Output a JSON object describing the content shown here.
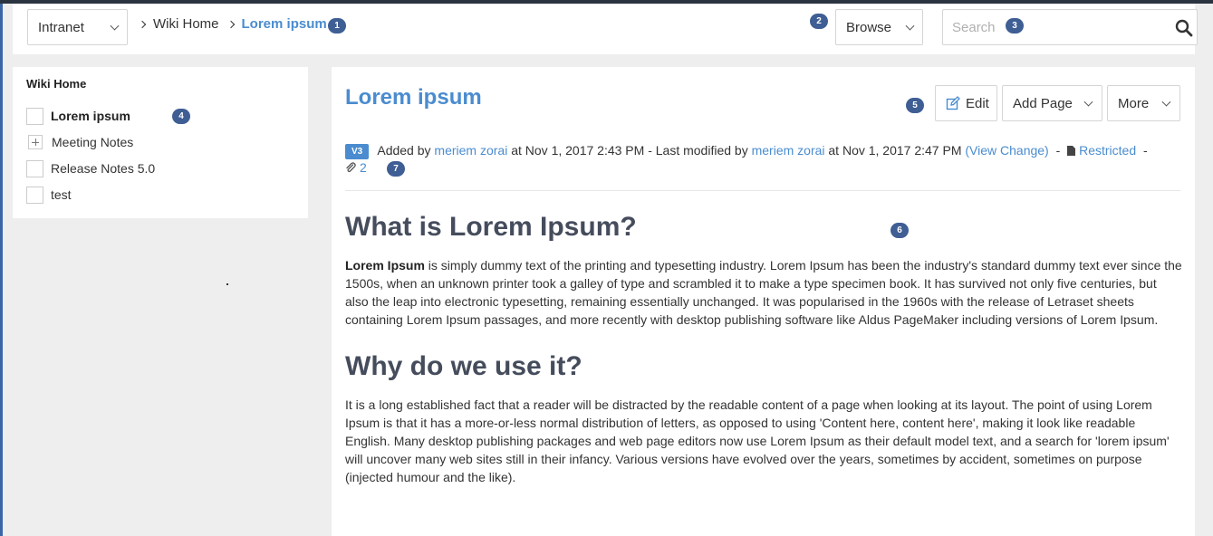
{
  "header": {
    "space_select": "Intranet",
    "breadcrumbs": [
      "Wiki Home",
      "Lorem ipsum"
    ],
    "browse_label": "Browse",
    "search_placeholder": "Search"
  },
  "badges": [
    "1",
    "2",
    "3",
    "4",
    "5",
    "6",
    "7"
  ],
  "sidebar": {
    "title": "Wiki Home",
    "items": [
      {
        "label": "Lorem ipsum",
        "active": true,
        "expandable": false
      },
      {
        "label": "Meeting Notes",
        "active": false,
        "expandable": true
      },
      {
        "label": "Release Notes 5.0",
        "active": false,
        "expandable": false
      },
      {
        "label": "test",
        "active": false,
        "expandable": false
      }
    ]
  },
  "page": {
    "title": "Lorem ipsum",
    "buttons": {
      "edit": "Edit",
      "add_page": "Add Page",
      "more": "More"
    },
    "meta": {
      "version": "V3",
      "added_by_prefix": "Added by",
      "author": "meriem zorai",
      "added_at": "at Nov 1, 2017 2:43 PM - Last modified by",
      "modifier": "meriem zorai",
      "modified_at": "at Nov 1, 2017 2:47 PM",
      "view_change": "(View Change)",
      "sep": "-",
      "restricted": "Restricted",
      "attachments": "2"
    },
    "sections": [
      {
        "heading": "What is Lorem Ipsum?",
        "lead_bold": "Lorem Ipsum",
        "body": " is simply dummy text of the printing and typesetting industry. Lorem Ipsum has been the industry's standard dummy text ever since the 1500s, when an unknown printer took a galley of type and scrambled it to make a type specimen book. It has survived not only five centuries, but also the leap into electronic typesetting, remaining essentially unchanged. It was popularised in the 1960s with the release of Letraset sheets containing Lorem Ipsum passages, and more recently with desktop publishing software like Aldus PageMaker including versions of Lorem Ipsum."
      },
      {
        "heading": "Why do we use it?",
        "body": "It is a long established fact that a reader will be distracted by the readable content of a page when looking at its layout. The point of using Lorem Ipsum is that it has a more-or-less normal distribution of letters, as opposed to using 'Content here, content here', making it look like readable English. Many desktop publishing packages and web page editors now use Lorem Ipsum as their default model text, and a search for 'lorem ipsum' will uncover many web sites still in their infancy. Various versions have evolved over the years, sometimes by accident, sometimes on purpose (injected humour and the like)."
      }
    ]
  },
  "colors": {
    "accent": "#4a8ccf",
    "badge": "#3e5e94",
    "heading": "#454c5c"
  }
}
